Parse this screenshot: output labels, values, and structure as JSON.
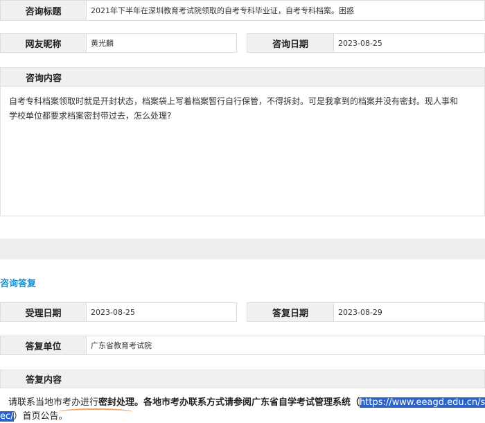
{
  "labels": {
    "subject": "咨询标题",
    "nickname": "网友昵称",
    "consult_date": "咨询日期",
    "consult_content": "咨询内容",
    "accept_date": "受理日期",
    "reply_date": "答复日期",
    "reply_unit": "答复单位",
    "reply_content": "答复内容"
  },
  "consult": {
    "subject": "2021年下半年在深圳教育考试院领取的自考专科毕业证，自考专科档案。困惑",
    "nickname": "黄光麟",
    "date": "2023-08-25",
    "content_line1": "自考专科档案领取时就是开封状态，档案袋上写着档案暂行自行保管，不得拆封。可是我拿到的档案并没有密封。现人事和",
    "content_line2": "学校单位都要求档案密封带过去，怎么处理?"
  },
  "reply": {
    "section_title": "咨询答复",
    "accept_date": "2023-08-25",
    "reply_date": "2023-08-29",
    "unit": "广东省教育考试院",
    "text_part1": "请联系当地市考办进行",
    "text_bold1": "密封处理",
    "text_part2": "。各地市考办联系方式请参阅广东省自学考试管理系统（",
    "link_part1": "https://www.eeagd.edu.cn/self",
    "link_part2": "ec/",
    "text_part3": "）首页公告。"
  },
  "colors": {
    "section_title": "#1a8fd1",
    "highlight": "#2b63c6",
    "annotation_underline": "#f2a25c"
  }
}
